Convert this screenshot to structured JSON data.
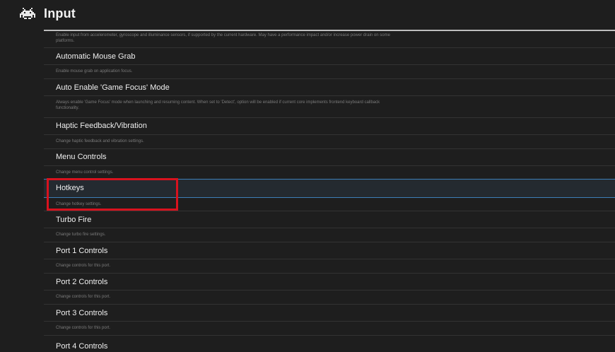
{
  "header": {
    "title": "Input",
    "logo_icon": "space-invader-icon"
  },
  "top_partial": {
    "desc_line1": "Enable input from accelerometer, gyroscope and illuminance sensors, if supported by the current hardware. May have a performance impact and/or increase power drain on some",
    "desc_line2": "platforms."
  },
  "items": [
    {
      "title": "Automatic Mouse Grab",
      "desc": "Enable mouse grab on application focus."
    },
    {
      "title": "Auto Enable 'Game Focus' Mode",
      "desc": "Always enable 'Game Focus' mode when launching and resuming content. When set to 'Detect', option will be enabled if current core implements frontend keyboard callback",
      "desc2": "functionality."
    },
    {
      "title": "Haptic Feedback/Vibration",
      "desc": "Change haptic feedback and vibration settings."
    },
    {
      "title": "Menu Controls",
      "desc": "Change menu control settings."
    },
    {
      "title": "Hotkeys",
      "desc": "Change hotkey settings."
    },
    {
      "title": "Turbo Fire",
      "desc": "Change turbo fire settings."
    },
    {
      "title": "Port 1 Controls",
      "desc": "Change controls for this port."
    },
    {
      "title": "Port 2 Controls",
      "desc": "Change controls for this port."
    },
    {
      "title": "Port 3 Controls",
      "desc": "Change controls for this port."
    },
    {
      "title": "Port 4 Controls",
      "desc": ""
    }
  ],
  "selected_index": 4,
  "colors": {
    "accent": "#3d7fb8",
    "highlight_box": "#d8121e",
    "background": "#1e1e1e"
  }
}
